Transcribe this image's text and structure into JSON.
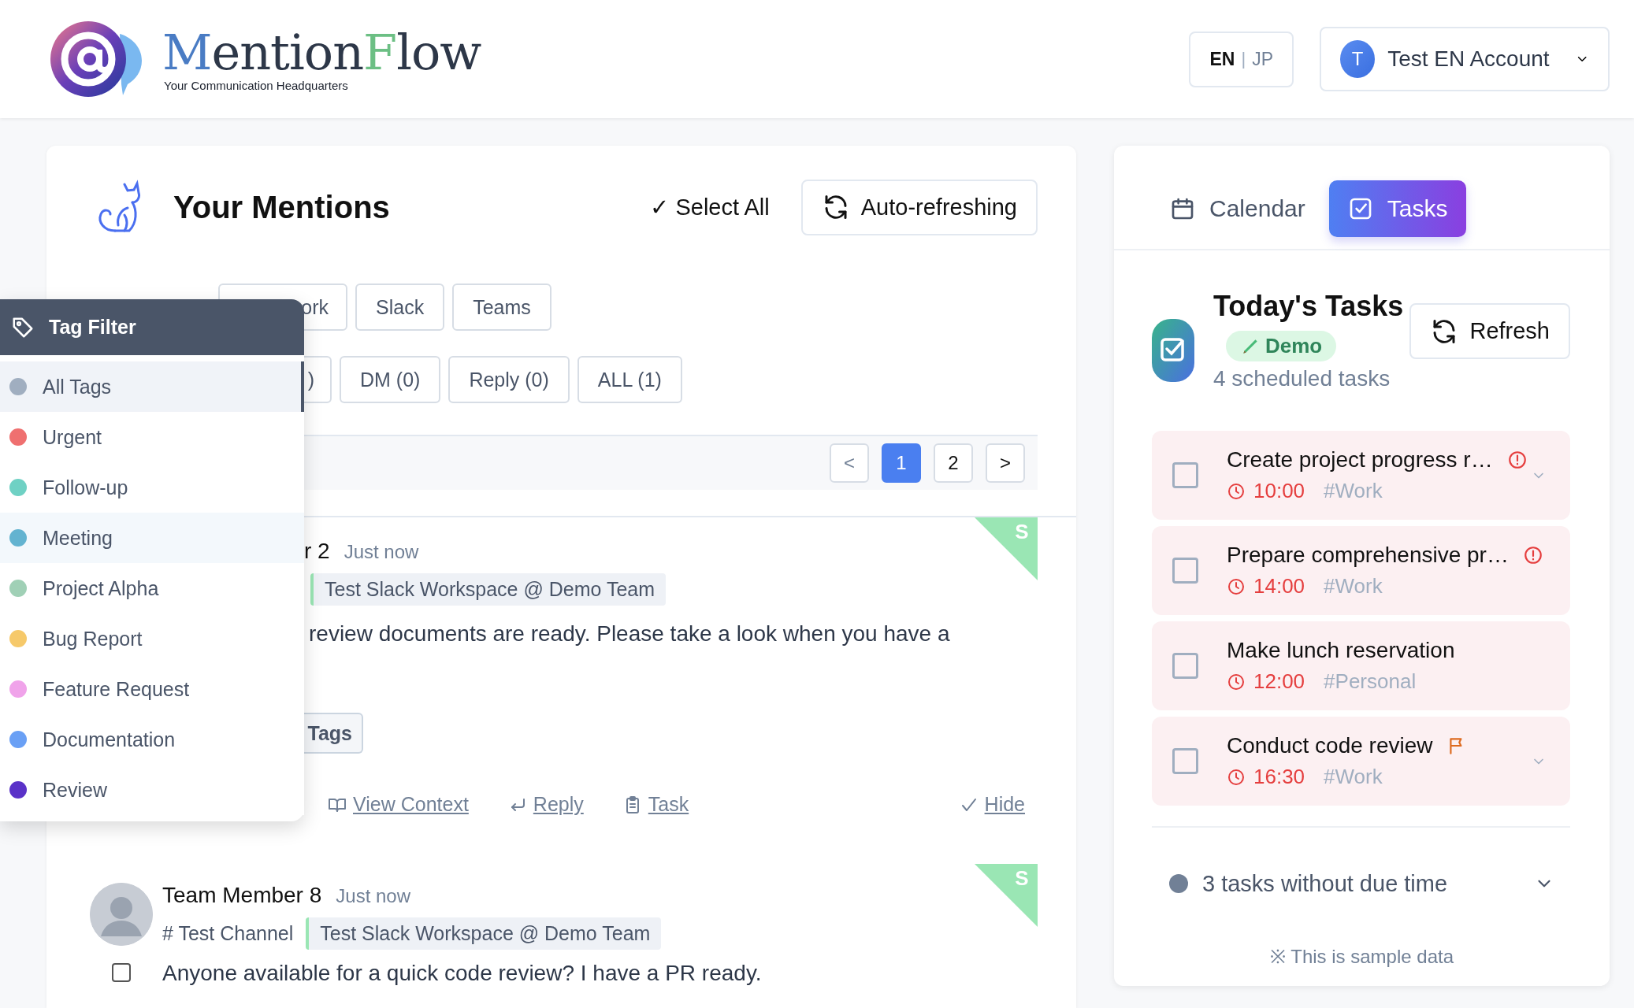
{
  "header": {
    "title_segments": [
      {
        "text": "M",
        "color": "#4a7cc4"
      },
      {
        "text": "ention",
        "color": "#2d3748"
      },
      {
        "text": "F",
        "color": "#6cbf84"
      },
      {
        "text": "low",
        "color": "#2d3748"
      }
    ],
    "tagline": "Your Communication Headquarters",
    "languages": [
      {
        "label": "EN",
        "selected": true
      },
      {
        "label": "JP",
        "selected": false
      }
    ],
    "language_separator": "|",
    "account": {
      "initial": "T",
      "name": "Test EN Account"
    }
  },
  "mentions": {
    "title": "Your Mentions",
    "select_all": "✓ Select All",
    "auto_refresh": "Auto-refreshing",
    "source_filters": [
      {
        "label": "ork",
        "selected": false
      },
      {
        "label": "Slack",
        "selected": false
      },
      {
        "label": "Teams",
        "selected": false
      }
    ],
    "type_filters": [
      {
        "label": ")",
        "selected": false
      },
      {
        "label": "DM (0)",
        "selected": false
      },
      {
        "label": "Reply (0)",
        "selected": false
      },
      {
        "label": "ALL (1)",
        "selected": false
      }
    ],
    "prev": "<",
    "next": ">",
    "pages": [
      {
        "label": "1",
        "selected": true
      },
      {
        "label": "2",
        "selected": false
      }
    ],
    "items": [
      {
        "kind": "partial",
        "author": "r 2",
        "time": "Just now",
        "workspace": "Test Slack Workspace @ Demo Team",
        "text": "review documents are ready. Please take a look when you have a",
        "tags_button": "Tags",
        "source_badge": "S",
        "actions": [
          "View Context",
          "Reply",
          "Task",
          "Hide"
        ]
      },
      {
        "kind": "full",
        "author": "Team Member 8",
        "time": "Just now",
        "channel": "# Test Channel",
        "workspace": "Test Slack Workspace @ Demo Team",
        "text": "Anyone available for a quick code review? I have a PR ready.",
        "source_badge": "S",
        "checked": false
      }
    ]
  },
  "tag_filter": {
    "title": "Tag Filter",
    "tags": [
      {
        "label": "All Tags",
        "color": "#a0aec0",
        "selected": true,
        "hovered": false
      },
      {
        "label": "Urgent",
        "color": "#ef7070",
        "selected": false,
        "hovered": false
      },
      {
        "label": "Follow-up",
        "color": "#6fd1c4",
        "selected": false,
        "hovered": false
      },
      {
        "label": "Meeting",
        "color": "#63b3d0",
        "selected": false,
        "hovered": true
      },
      {
        "label": "Project Alpha",
        "color": "#a0d0b6",
        "selected": false,
        "hovered": false
      },
      {
        "label": "Bug Report",
        "color": "#f6c96a",
        "selected": false,
        "hovered": false
      },
      {
        "label": "Feature Request",
        "color": "#f0a3ea",
        "selected": false,
        "hovered": false
      },
      {
        "label": "Documentation",
        "color": "#6aa0f5",
        "selected": false,
        "hovered": false
      },
      {
        "label": "Review",
        "color": "#5a32c8",
        "selected": false,
        "hovered": false
      }
    ]
  },
  "tasks_panel": {
    "tabs": [
      {
        "label": "Calendar",
        "selected": false
      },
      {
        "label": "Tasks",
        "selected": true
      }
    ],
    "title": "Today's Tasks",
    "badge": "Demo",
    "count": "4 scheduled tasks",
    "refresh": "Refresh",
    "tasks": [
      {
        "title": "Create project progress r…",
        "time": "10:00",
        "tag": "#Work",
        "checked": false,
        "alert": true,
        "flagged": false,
        "expandable": true
      },
      {
        "title": "Prepare comprehensive pr…",
        "time": "14:00",
        "tag": "#Work",
        "checked": false,
        "alert": true,
        "flagged": false,
        "expandable": false
      },
      {
        "title": "Make lunch reservation",
        "time": "12:00",
        "tag": "#Personal",
        "checked": false,
        "alert": false,
        "flagged": false,
        "expandable": false
      },
      {
        "title": "Conduct code review",
        "time": "16:30",
        "tag": "#Work",
        "checked": false,
        "alert": false,
        "flagged": true,
        "expandable": true
      }
    ],
    "undated": {
      "label": "3 tasks without due time",
      "expanded": false
    },
    "footnote": "※ This is sample data"
  }
}
